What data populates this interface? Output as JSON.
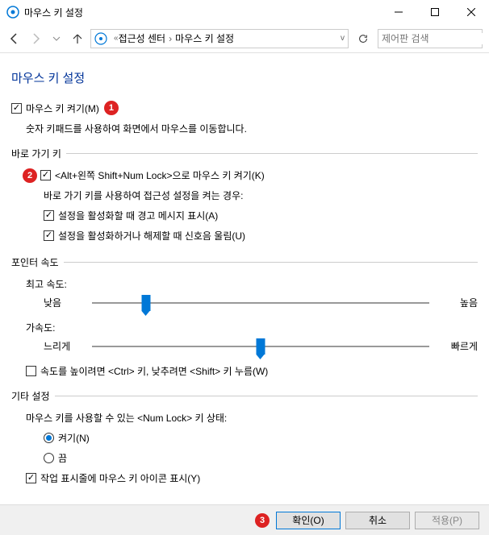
{
  "titlebar": {
    "title": "마우스 키 설정"
  },
  "breadcrumb": {
    "part1": "접근성 센터",
    "part2": "마우스 키 설정"
  },
  "search": {
    "placeholder": "제어판 검색"
  },
  "page": {
    "title": "마우스 키 설정"
  },
  "turnOn": {
    "label": "마우스 키 켜기(M)",
    "checked": true,
    "desc": "숫자 키패드를 사용하여 화면에서 마우스를 이동합니다."
  },
  "shortcut": {
    "groupLabel": "바로 가기 키",
    "label": "<Alt+왼쪽 Shift+Num Lock>으로 마우스 키 켜기(K)",
    "checked": true,
    "desc": "바로 가기 키를 사용하여 접근성 설정을 켜는 경우:",
    "opt1": {
      "label": "설정을 활성화할 때 경고 메시지 표시(A)",
      "checked": true
    },
    "opt2": {
      "label": "설정을 활성화하거나 해제할 때 신호음 울림(U)",
      "checked": true
    }
  },
  "pointer": {
    "groupLabel": "포인터 속도",
    "topSpeed": {
      "label": "최고 속도:",
      "low": "낮음",
      "high": "높음",
      "valuePercent": 16
    },
    "accel": {
      "label": "가속도:",
      "low": "느리게",
      "high": "빠르게",
      "valuePercent": 50
    },
    "ctrlShift": {
      "label": "속도를 높이려면 <Ctrl> 키, 낮추려면 <Shift> 키 누름(W)",
      "checked": false
    }
  },
  "other": {
    "groupLabel": "기타 설정",
    "numlockLabel": "마우스 키를 사용할 수 있는 <Num Lock> 키 상태:",
    "radioOn": "켜기(N)",
    "radioOff": "끔",
    "taskbar": {
      "label": "작업 표시줄에 마우스 키 아이콘 표시(Y)",
      "checked": true
    }
  },
  "buttons": {
    "ok": "확인(O)",
    "cancel": "취소",
    "apply": "적용(P)"
  },
  "badges": {
    "b1": "1",
    "b2": "2",
    "b3": "3"
  }
}
